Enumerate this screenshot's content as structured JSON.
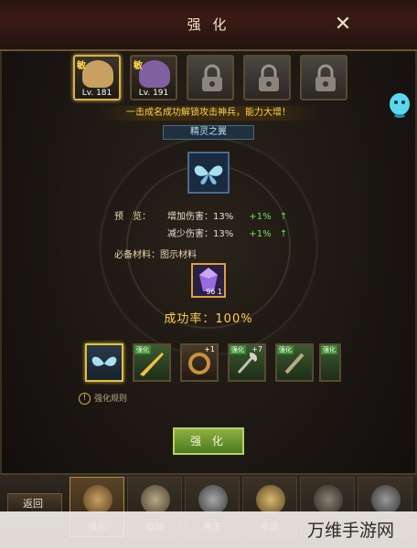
{
  "window": {
    "title": "强 化"
  },
  "heroes": [
    {
      "tag": "敏",
      "level": "Lv. 181",
      "state": "active",
      "color": "#c8a060"
    },
    {
      "tag": "敏",
      "level": "Lv. 191",
      "state": "normal",
      "color": "#8060a0"
    },
    {
      "state": "locked"
    },
    {
      "state": "locked"
    },
    {
      "state": "locked"
    }
  ],
  "banner": "一击成名成功解锁攻击神兵，能力大增！",
  "item_name": "精灵之翼",
  "preview": {
    "label": "预　览：",
    "stats": [
      {
        "name": "增加伤害：13%",
        "gain": "+1%",
        "arrow": "↑"
      },
      {
        "name": "减少伤害：13%",
        "gain": "+1%",
        "arrow": "↑"
      }
    ]
  },
  "material": {
    "label": "必备材料：图示材料",
    "count": "96 1"
  },
  "success": "成功率：100%",
  "equipment": [
    {
      "selected": true,
      "level": "",
      "badge": "",
      "icon": "wings-icon"
    },
    {
      "selected": false,
      "level": "",
      "badge": "强化",
      "icon": "blade-icon"
    },
    {
      "selected": false,
      "level": "+1",
      "badge": "",
      "icon": "ring-icon"
    },
    {
      "selected": false,
      "level": "+7",
      "badge": "强化",
      "icon": "axe-icon"
    },
    {
      "selected": false,
      "level": "",
      "badge": "强化",
      "icon": "dagger-icon"
    },
    {
      "selected": false,
      "level": "",
      "badge": "强化",
      "icon": "spear-icon"
    }
  ],
  "rules": "强化规则",
  "strengthen_button": "强 化",
  "back_button": "返回",
  "tabs": [
    {
      "label": "强化",
      "active": true
    },
    {
      "label": "追加",
      "active": false
    },
    {
      "label": "再生",
      "active": false
    },
    {
      "label": "幸运",
      "active": false
    },
    {
      "label": "",
      "active": false
    },
    {
      "label": "",
      "active": false
    }
  ],
  "watermark": "万维手游网",
  "colors": {
    "accent_gold": "#ffcf4a",
    "gain_green": "#6ee060",
    "button_green": "#6a9a30"
  }
}
